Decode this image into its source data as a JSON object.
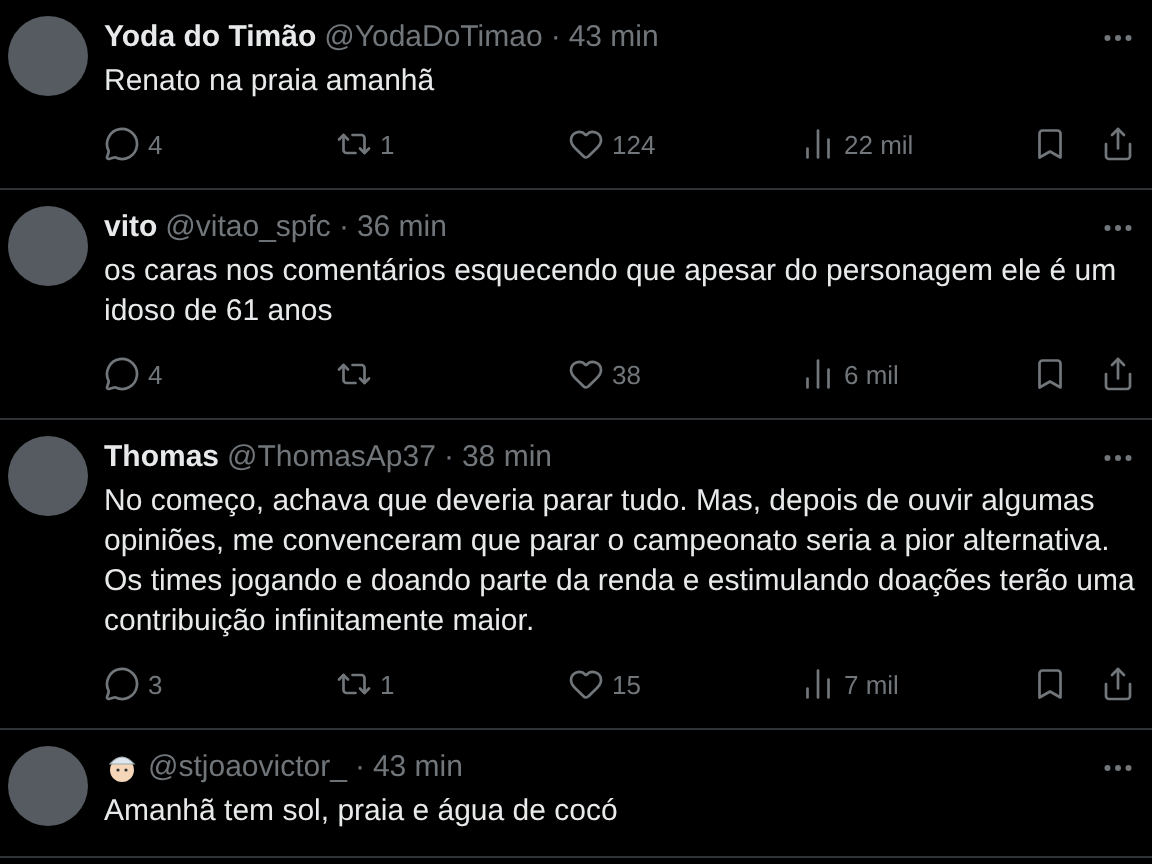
{
  "tweets": [
    {
      "name": "Yoda do Timão",
      "handle": "@YodaDoTimao",
      "separator": "·",
      "time": "43 min",
      "text": "Renato na praia amanhã",
      "actions": [
        {
          "kind": "reply",
          "count": "4"
        },
        {
          "kind": "retweet",
          "count": "1"
        },
        {
          "kind": "like",
          "count": "124"
        },
        {
          "kind": "views",
          "count": "22 mil"
        }
      ]
    },
    {
      "name": "vito",
      "handle": "@vitao_spfc",
      "separator": "·",
      "time": "36 min",
      "text": "os caras nos comentários esquecendo que apesar do personagem ele é um idoso de 61 anos",
      "actions": [
        {
          "kind": "reply",
          "count": "4"
        },
        {
          "kind": "retweet"
        },
        {
          "kind": "like",
          "count": "38"
        },
        {
          "kind": "views",
          "count": "6 mil"
        }
      ]
    },
    {
      "name": "Thomas",
      "handle": "@ThomasAp37",
      "separator": "·",
      "time": "38 min",
      "text": "No começo, achava que deveria parar tudo. Mas, depois de ouvir algumas opiniões, me convenceram que parar o campeonato seria a pior alternativa. Os times jogando e doando parte da renda e estimulando doações terão uma contribuição infinitamente maior.",
      "actions": [
        {
          "kind": "reply",
          "count": "3"
        },
        {
          "kind": "retweet",
          "count": "1"
        },
        {
          "kind": "like",
          "count": "15"
        },
        {
          "kind": "views",
          "count": "7 mil"
        }
      ]
    },
    {
      "name_is_emoji": true,
      "handle": "@stjoaovictor_",
      "separator": "·",
      "time": "43 min",
      "text": "Amanhã tem sol, praia e água de cocó"
    }
  ]
}
